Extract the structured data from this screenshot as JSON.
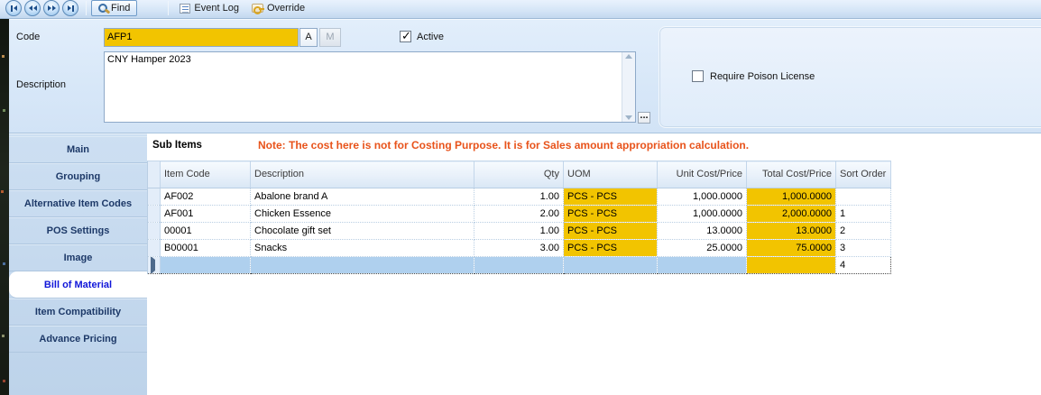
{
  "toolbar": {
    "find_label": "Find",
    "event_log_label": "Event Log",
    "override_label": "Override",
    "icons": {
      "nav": [
        "first-record-icon",
        "previous-record-icon",
        "next-record-icon",
        "last-record-icon"
      ],
      "find": "magnifier-icon",
      "event_log": "event-log-icon",
      "override": "key-scroll-icon"
    }
  },
  "form": {
    "code": {
      "label": "Code",
      "value": "AFP1",
      "a_button": "A",
      "m_button": "M"
    },
    "active": {
      "label": "Active",
      "checked": true
    },
    "description": {
      "label": "Description",
      "value": "CNY Hamper 2023",
      "more_button": "..."
    },
    "options_panel": {
      "require_poison_license": {
        "label": "Require Poison License",
        "checked": false
      }
    }
  },
  "sidebar": {
    "tabs": [
      {
        "label": "Main",
        "selected": false
      },
      {
        "label": "Grouping",
        "selected": false
      },
      {
        "label": "Alternative Item Codes",
        "selected": false
      },
      {
        "label": "POS Settings",
        "selected": false
      },
      {
        "label": "Image",
        "selected": false
      },
      {
        "label": "Bill of Material",
        "selected": true
      },
      {
        "label": "Item Compatibility",
        "selected": false
      },
      {
        "label": "Advance Pricing",
        "selected": false
      }
    ]
  },
  "sub_items": {
    "title": "Sub Items",
    "note": "Note: The cost here is not for Costing Purpose. It is for Sales amount appropriation calculation.",
    "columns": [
      "Item Code",
      "Description",
      "Qty",
      "UOM",
      "Unit Cost/Price",
      "Total Cost/Price",
      "Sort Order"
    ],
    "rows": [
      {
        "item_code": "AF002",
        "description": "Abalone brand A",
        "qty": "1.00",
        "uom": "PCS - PCS",
        "unit_cost": "1,000.0000",
        "total_cost": "1,000.0000",
        "sort_order": ""
      },
      {
        "item_code": "AF001",
        "description": "Chicken Essence",
        "qty": "2.00",
        "uom": "PCS - PCS",
        "unit_cost": "1,000.0000",
        "total_cost": "2,000.0000",
        "sort_order": "1"
      },
      {
        "item_code": "00001",
        "description": "Chocolate gift set",
        "qty": "1.00",
        "uom": "PCS - PCS",
        "unit_cost": "13.0000",
        "total_cost": "13.0000",
        "sort_order": "2"
      },
      {
        "item_code": "B00001",
        "description": "Snacks",
        "qty": "3.00",
        "uom": "PCS - PCS",
        "unit_cost": "25.0000",
        "total_cost": "75.0000",
        "sort_order": "3"
      }
    ],
    "new_row": {
      "item_code": "",
      "description": "",
      "qty": "",
      "uom": "",
      "unit_cost": "",
      "total_cost": "",
      "sort_order": "4"
    }
  },
  "colors": {
    "highlight_yellow": "#F2C400",
    "note_orange": "#E8531B",
    "selected_row_blue": "#AFD0EE",
    "selected_tab_text": "#1016D9"
  }
}
